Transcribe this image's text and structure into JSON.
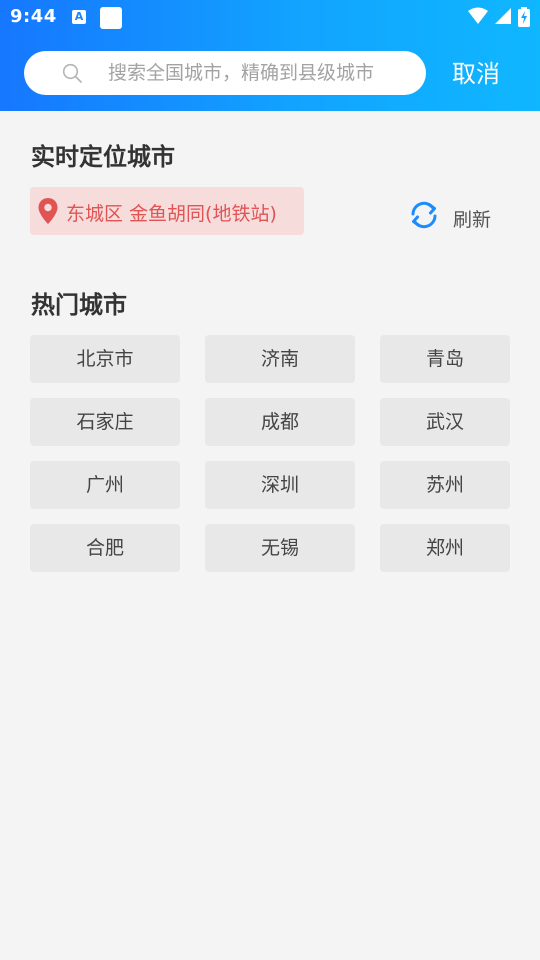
{
  "status_bar": {
    "time": "9:44",
    "left_icons": [
      "a-font-icon",
      "app-square-icon"
    ],
    "right_icons": [
      "wifi-icon",
      "cellular-signal-icon",
      "battery-charging-icon"
    ]
  },
  "search": {
    "placeholder": "搜索全国城市，精确到县级城市",
    "value": "",
    "icon": "search-icon",
    "cancel_label": "取消"
  },
  "realtime_location": {
    "title": "实时定位城市",
    "location_text": "东城区 金鱼胡同(地铁站)",
    "icon": "map-pin-icon",
    "refresh_label": "刷新",
    "refresh_icon": "refresh-icon"
  },
  "hot_cities": {
    "title": "热门城市",
    "cities": [
      "北京市",
      "济南",
      "青岛",
      "石家庄",
      "成都",
      "武汉",
      "广州",
      "深圳",
      "苏州",
      "合肥",
      "无锡",
      "郑州"
    ]
  },
  "colors": {
    "header_gradient_start": "#1677ff",
    "header_gradient_end": "#0fb7ff",
    "location_text": "#e05454",
    "location_bg": "#f7dcdc",
    "refresh_icon": "#1a8cff",
    "page_bg": "#f4f4f4",
    "city_cell_bg": "#e8e8e8"
  }
}
